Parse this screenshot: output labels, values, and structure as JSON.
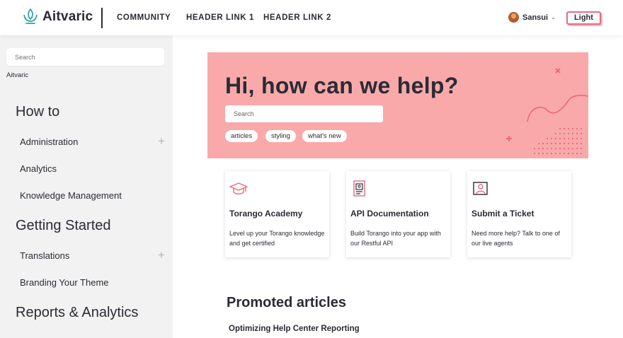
{
  "header": {
    "brand": "Aitvaric",
    "nav": [
      "COMMUNITY",
      "HEADER LINK 1",
      "HEADER LINK 2"
    ],
    "user_name": "Sansui",
    "theme_button": "Light"
  },
  "sidebar": {
    "search_placeholder": "Search",
    "breadcrumb": "Aitvaric",
    "sections": [
      {
        "title": "How to",
        "items": [
          "Administration",
          "Analytics",
          "Knowledge Management"
        ]
      },
      {
        "title": "Getting Started",
        "items": [
          "Translations",
          "Branding Your Theme"
        ]
      },
      {
        "title": "Reports & Analytics",
        "items": []
      }
    ]
  },
  "hero": {
    "title": "Hi, how can we help?",
    "search_placeholder": "Search",
    "tags": [
      "articles",
      "styling",
      "what's new"
    ]
  },
  "cards": [
    {
      "icon": "graduation-cap-icon",
      "title": "Torango Academy",
      "desc": "Level up your Torango knowledge and get certified"
    },
    {
      "icon": "document-icon",
      "title": "API Documentation",
      "desc": "Build Torango into your app with our Restful API"
    },
    {
      "icon": "ticket-icon",
      "title": "Submit a Ticket",
      "desc": "Need more help? Talk to one of our live agents"
    }
  ],
  "promoted": {
    "title": "Promoted articles",
    "articles": [
      "Optimizing Help Center Reporting"
    ]
  },
  "colors": {
    "accent": "#e86a7f",
    "hero_bg": "#f9a9a9",
    "sidebar_bg": "#f2f2f2",
    "text": "#2b2b36",
    "logo": "#2aa59a"
  }
}
